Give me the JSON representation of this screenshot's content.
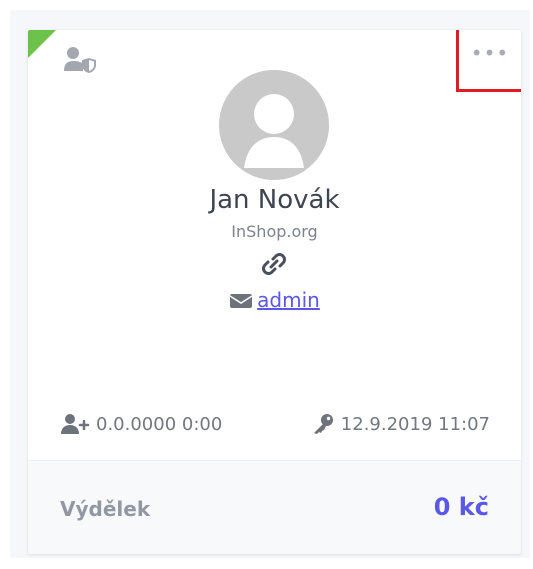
{
  "colors": {
    "accent": "#5b57e7",
    "corner_flag": "#6cc24a",
    "highlight_border": "#e01b23",
    "avatar_bg": "#c9c9c9"
  },
  "user_card": {
    "name": "Jan Novák",
    "organization": "InShop.org",
    "role_icon": "user-shield-icon",
    "link_icon": "link-icon",
    "mail_icon": "envelope-icon",
    "admin_link": "admin",
    "menu_icon": "more-horizontal-icon"
  },
  "stats": {
    "registered_icon": "user-plus-icon",
    "registered": "0.0.0000 0:00",
    "last_login_icon": "key-icon",
    "last_login": "12.9.2019 11:07"
  },
  "footer": {
    "label": "Výdělek",
    "value": "0 kč"
  }
}
